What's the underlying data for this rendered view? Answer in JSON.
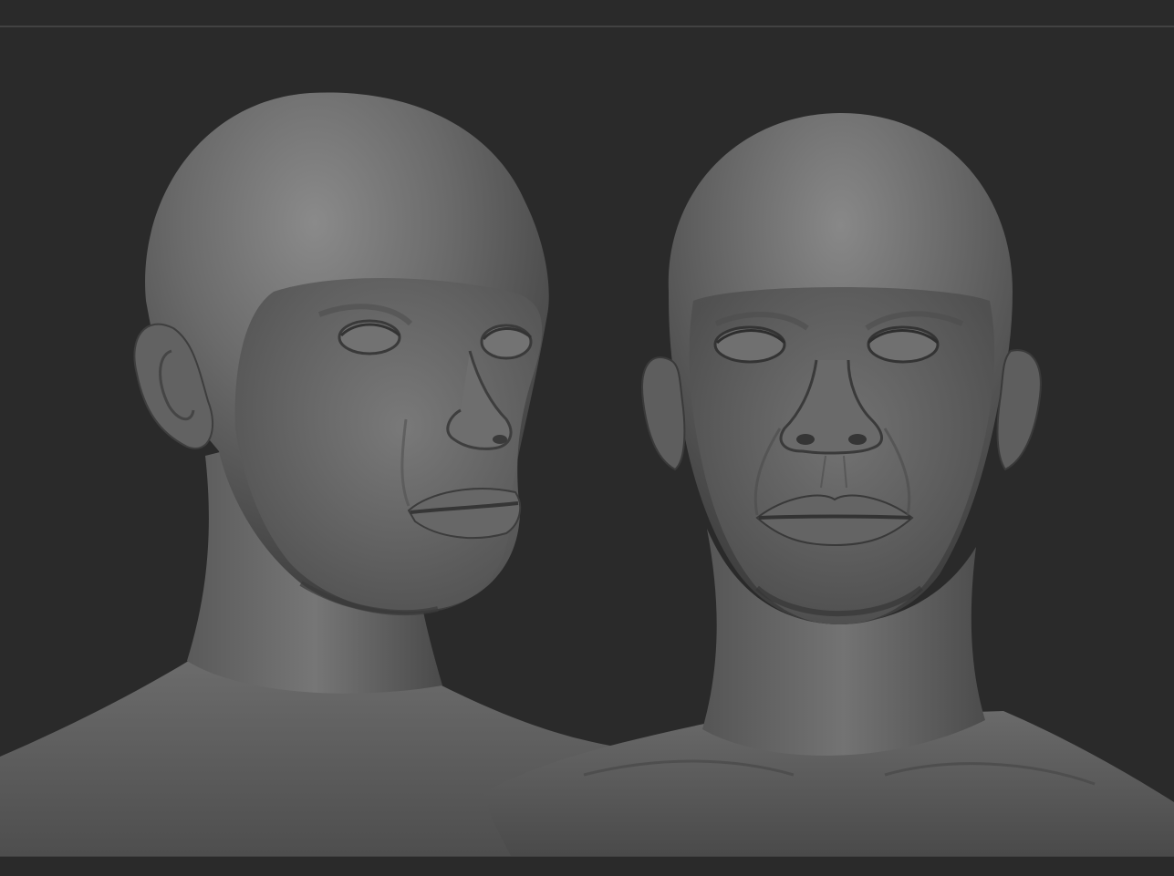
{
  "viewport": {
    "background_color": "#2a2a2a",
    "frame_line_color": "#5a5a5a",
    "sculpt_color": "#6e6e6e"
  },
  "models": [
    {
      "name": "head-three-quarter-view",
      "view": "three-quarter"
    },
    {
      "name": "head-front-view",
      "view": "front"
    }
  ]
}
